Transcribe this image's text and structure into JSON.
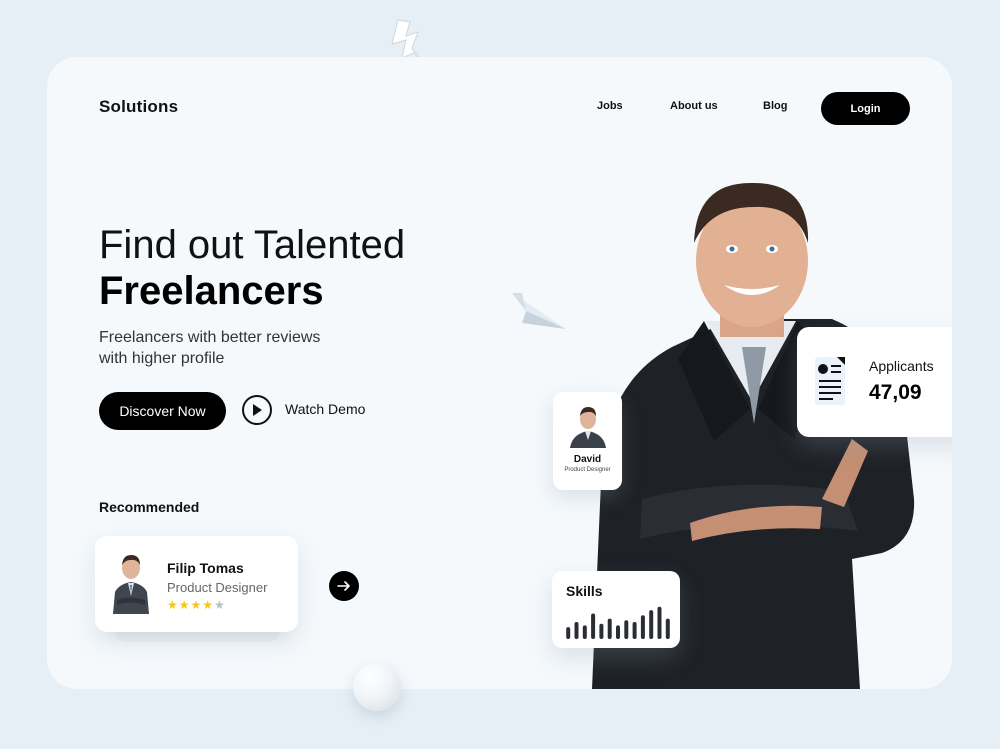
{
  "header": {
    "logo": "Solutions",
    "nav": [
      "Jobs",
      "About us",
      "Blog"
    ],
    "login_label": "Login"
  },
  "hero": {
    "title_light": "Find out Talented",
    "title_bold": "Freelancers",
    "subtitle_line1": "Freelancers with better reviews",
    "subtitle_line2": "with higher profile",
    "discover_label": "Discover Now",
    "watch_label": "Watch Demo"
  },
  "recommended": {
    "heading": "Recommended",
    "card": {
      "name": "Filip Tomas",
      "role": "Product Designer",
      "rating": 4,
      "rating_max": 5
    }
  },
  "profile_card": {
    "name": "David",
    "role": "Product Designer"
  },
  "applicants_card": {
    "label": "Applicants",
    "value": "47,09"
  },
  "skills_card": {
    "label": "Skills",
    "bar_levels": [
      0.35,
      0.5,
      0.4,
      0.75,
      0.45,
      0.6,
      0.4,
      0.55,
      0.5,
      0.7,
      0.85,
      0.95,
      0.6
    ]
  },
  "colors": {
    "background": "#e7eff6",
    "card": "#f5f9fc",
    "accent": "#000000",
    "star": "#f5c518"
  },
  "icons": [
    "lightning-icon",
    "play-icon",
    "arrow-right-icon",
    "paper-plane-icon",
    "document-icon",
    "star-icon"
  ]
}
